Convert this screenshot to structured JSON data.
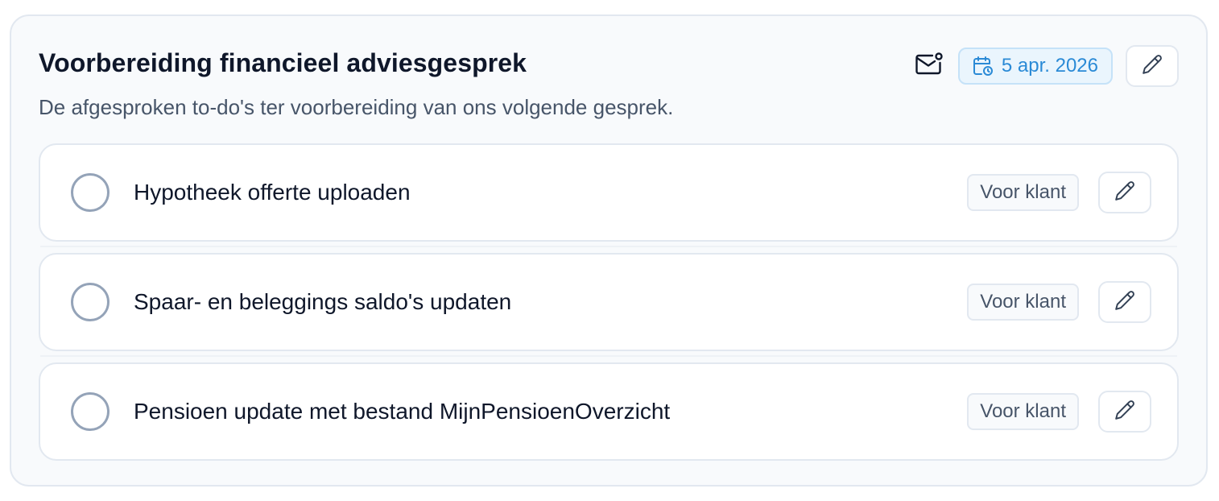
{
  "card": {
    "title": "Voorbereiding financieel adviesgesprek",
    "subtitle": "De afgesproken to-do's ter voorbereiding van ons volgende gesprek.",
    "date": "5 apr. 2026"
  },
  "icons": {
    "mail": "mail-notification-icon",
    "calendar": "calendar-clock-icon",
    "edit": "pencil-icon"
  },
  "colors": {
    "accent": "#2a8ad6",
    "date_badge_bg": "#eaf5fd",
    "checkbox_border": "#94a3b8"
  },
  "todos": [
    {
      "label": "Hypotheek offerte uploaden",
      "tag": "Voor klant",
      "done": false
    },
    {
      "label": "Spaar- en beleggings saldo's updaten",
      "tag": "Voor klant",
      "done": false
    },
    {
      "label": "Pensioen update met bestand MijnPensioenOverzicht",
      "tag": "Voor klant",
      "done": false
    }
  ]
}
